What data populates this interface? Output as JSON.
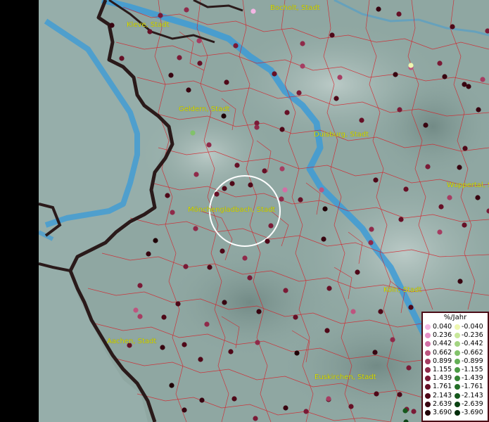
{
  "map": {
    "cities": [
      {
        "name": "Bocholt, Stadt"
      },
      {
        "name": "Kleve, Stadt"
      },
      {
        "name": "Geldern, Stadt"
      },
      {
        "name": "Duisburg, Stadt"
      },
      {
        "name": "Wuppertal, St"
      },
      {
        "name": "Mönchengladbach, Stadt"
      },
      {
        "name": "Köln, Stadt"
      },
      {
        "name": "Aachen, Stadt"
      },
      {
        "name": "Euskirchen, Stadt"
      }
    ]
  },
  "legend": {
    "title": "%/Jahr",
    "positive": [
      "0.040",
      "0.236",
      "0.442",
      "0.662",
      "0.899",
      "1.155",
      "1.439",
      "1.761",
      "2.143",
      "2.639",
      "3.690"
    ],
    "negative": [
      "-0.040",
      "-0.236",
      "-0.442",
      "-0.662",
      "-0.899",
      "-1.155",
      "-1.439",
      "-1.761",
      "-2.143",
      "-2.639",
      "-3.690"
    ],
    "positive_colors": [
      "#f4b6e4",
      "#e690c8",
      "#d26fa6",
      "#bd557f",
      "#a63d62",
      "#8f2a4a",
      "#7a1a36",
      "#661026",
      "#4f0818",
      "#380410",
      "#200006"
    ],
    "negative_colors": [
      "#eef7b0",
      "#c7e79a",
      "#a3d482",
      "#82c26b",
      "#63ae55",
      "#4b9a44",
      "#358434",
      "#236e27",
      "#15581c",
      "#0b4213",
      "#022c0a"
    ]
  }
}
